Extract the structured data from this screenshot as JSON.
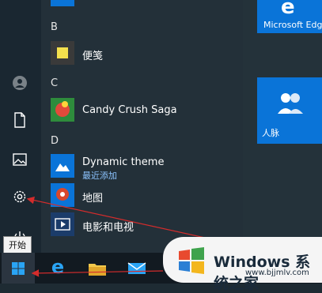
{
  "start_menu": {
    "letters": {
      "b": "B",
      "c": "C",
      "d": "D"
    },
    "apps": [
      {
        "name": "便笺",
        "subtitle": ""
      },
      {
        "name": "Candy Crush Saga",
        "subtitle": ""
      },
      {
        "name": "Dynamic theme",
        "subtitle": "最近添加"
      },
      {
        "name": "地图",
        "subtitle": ""
      },
      {
        "name": "电影和电视",
        "subtitle": ""
      }
    ]
  },
  "tiles": [
    {
      "name": "Microsoft Edge",
      "color": "#0a74d8"
    },
    {
      "name": "人脉",
      "color": "#0a74d8"
    }
  ],
  "tooltip": "开始",
  "watermark": {
    "title": "Windows 系统之家",
    "site": "www.bjjmlv.com"
  },
  "colors": {
    "accent": "#0a74d8",
    "annotation_arrow": "#d42c2c"
  }
}
